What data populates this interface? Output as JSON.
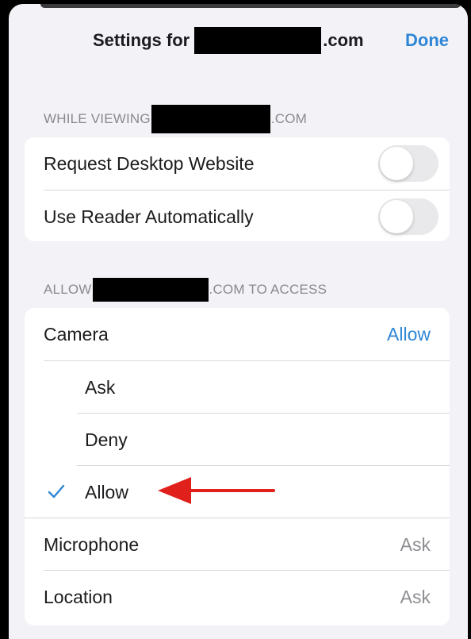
{
  "header": {
    "title_prefix": "Settings for",
    "title_suffix": ".com",
    "done_label": "Done"
  },
  "viewing_section": {
    "header_prefix": "WHILE VIEWING",
    "header_suffix": ".COM",
    "rows": [
      {
        "label": "Request Desktop Website",
        "toggle": "off"
      },
      {
        "label": "Use Reader Automatically",
        "toggle": "off"
      }
    ]
  },
  "access_section": {
    "header_prefix": "ALLOW",
    "header_suffix": ".COM TO ACCESS",
    "camera": {
      "label": "Camera",
      "value": "Allow"
    },
    "camera_options": [
      {
        "label": "Ask",
        "selected": false
      },
      {
        "label": "Deny",
        "selected": false
      },
      {
        "label": "Allow",
        "selected": true
      }
    ],
    "microphone": {
      "label": "Microphone",
      "value": "Ask"
    },
    "location": {
      "label": "Location",
      "value": "Ask"
    }
  },
  "colors": {
    "accent": "#2f86d6",
    "background": "#f2f2f7",
    "annotation_arrow": "#e0201b"
  },
  "icons": [
    "checkmark-icon",
    "red-arrow-icon"
  ]
}
